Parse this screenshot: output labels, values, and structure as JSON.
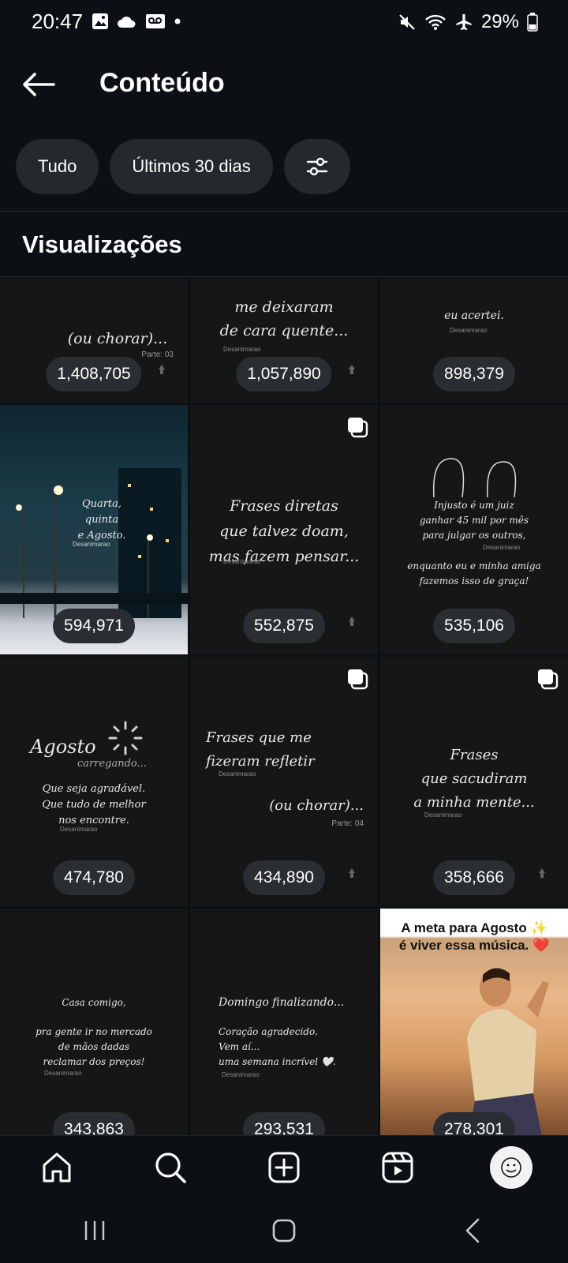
{
  "status": {
    "time": "20:47",
    "battery": "29%"
  },
  "header": {
    "title": "Conteúdo"
  },
  "filters": [
    {
      "label": "Tudo"
    },
    {
      "label": "Últimos 30 dias"
    }
  ],
  "section": {
    "title": "Visualizações"
  },
  "tiles": [
    {
      "views": "1,408,705",
      "text": [
        "(ou chorar)..."
      ],
      "part": "Parte: 03"
    },
    {
      "views": "1,057,890",
      "text": [
        "me deixaram",
        "de cara quente..."
      ],
      "handle": "Desanimarao"
    },
    {
      "views": "898,379",
      "text": [
        "eu acertei."
      ],
      "handle": "Desanimarao"
    },
    {
      "views": "594,971",
      "text": [
        "Quarta,",
        "quinta",
        "e Agosto."
      ],
      "handle": "Desanimarao"
    },
    {
      "views": "552,875",
      "text": [
        "Frases diretas",
        "que talvez doam,",
        "mas fazem pensar..."
      ],
      "handle": "Desanimarao"
    },
    {
      "views": "535,106",
      "text": [
        "Injusto é um juiz",
        "ganhar 45 mil por mês",
        "para julgar os outros,",
        "enquanto eu e minha amiga",
        "fazemos isso de graça!"
      ],
      "handle": "Desanimarao"
    },
    {
      "views": "474,780",
      "text": [
        "Agosto",
        "carregando...",
        "Que seja agradável.",
        "Que tudo de melhor",
        "nos encontre."
      ],
      "handle": "Desanimarao"
    },
    {
      "views": "434,890",
      "text": [
        "Frases que me",
        "fizeram refletir",
        "(ou chorar)..."
      ],
      "part": "Parte: 04",
      "handle": "Desanimarao"
    },
    {
      "views": "358,666",
      "text": [
        "Frases",
        "que sacudiram",
        "a minha mente..."
      ],
      "handle": "Desanimarao"
    },
    {
      "views": "343,863",
      "text": [
        "Casa comigo,",
        "pra gente ir no mercado",
        "de mãos dadas",
        "reclamar dos preços!"
      ],
      "handle": "Desanimarao"
    },
    {
      "views": "293,531",
      "text": [
        "Domingo finalizando...",
        "Coração agradecido.",
        "Vem aí...",
        "uma semana incrível 🤍."
      ],
      "handle": "Desanimarao"
    },
    {
      "views": "278,301",
      "text": [
        "A meta para Agosto ✨",
        "é viver essa música. ❤️"
      ]
    }
  ]
}
